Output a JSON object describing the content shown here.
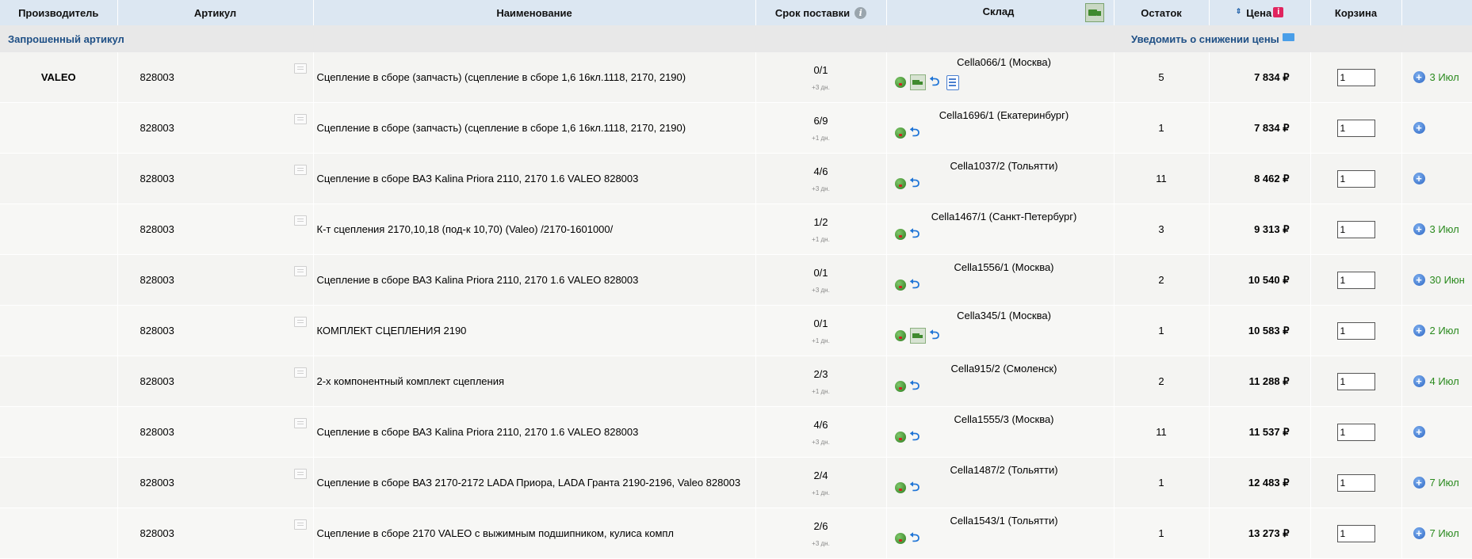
{
  "header": {
    "manufacturer": "Производитель",
    "article": "Артикул",
    "name": "Наименование",
    "delivery": "Срок поставки",
    "warehouse": "Склад",
    "stock": "Остаток",
    "price": "Цена",
    "cart": "Корзина"
  },
  "request": {
    "label": "Запрошенный артикул",
    "notify": "Уведомить о снижении цены"
  },
  "icons": {
    "info": "info-icon",
    "truck": "truck-icon",
    "return": "return-icon",
    "list": "list-icon",
    "add": "add-to-cart-icon",
    "envelope": "envelope-icon"
  },
  "colors": {
    "header_bg": "#dce7f2",
    "accent_blue": "#1e4f85",
    "date_green": "#2a8a1e"
  },
  "rows": [
    {
      "maker": "VALEO",
      "article": "828003",
      "name": "Сцепление в сборе (запчасть) (сцепление в сборе 1,6 16кл.1118, 2170, 2190)",
      "term": "0/1",
      "term_sub": "+3 дн.",
      "warehouse": "Cella066/1 (Москва)",
      "stock": "5",
      "price": "7 834 ₽",
      "qty": "1",
      "date": "3 Июл"
    },
    {
      "maker": "",
      "article": "828003",
      "name": "Сцепление в сборе (запчасть) (сцепление в сборе 1,6 16кл.1118, 2170, 2190)",
      "term": "6/9",
      "term_sub": "+1 дн.",
      "warehouse": "Cella1696/1 (Екатеринбург)",
      "stock": "1",
      "price": "7 834 ₽",
      "qty": "1",
      "date": ""
    },
    {
      "maker": "",
      "article": "828003",
      "name": "Сцепление в сборе ВАЗ Kalina Priora 2110, 2170 1.6 VALEO 828003",
      "term": "4/6",
      "term_sub": "+3 дн.",
      "warehouse": "Cella1037/2 (Тольятти)",
      "stock": "11",
      "price": "8 462 ₽",
      "qty": "1",
      "date": ""
    },
    {
      "maker": "",
      "article": "828003",
      "name": "К-т сцепления 2170,10,18 (под-к 10,70) (Valeo) /2170-1601000/",
      "term": "1/2",
      "term_sub": "+1 дн.",
      "warehouse": "Cella1467/1 (Санкт-Петербург)",
      "stock": "3",
      "price": "9 313 ₽",
      "qty": "1",
      "date": "3 Июл"
    },
    {
      "maker": "",
      "article": "828003",
      "name": "Сцепление в сборе ВАЗ Kalina Priora 2110, 2170 1.6 VALEO 828003",
      "term": "0/1",
      "term_sub": "+3 дн.",
      "warehouse": "Cella1556/1 (Москва)",
      "stock": "2",
      "price": "10 540 ₽",
      "qty": "1",
      "date": "30 Июн"
    },
    {
      "maker": "",
      "article": "828003",
      "name": "КОМПЛЕКТ СЦЕПЛЕНИЯ 2190",
      "term": "0/1",
      "term_sub": "+1 дн.",
      "warehouse": "Cella345/1 (Москва)",
      "stock": "1",
      "price": "10 583 ₽",
      "qty": "1",
      "date": "2 Июл"
    },
    {
      "maker": "",
      "article": "828003",
      "name": "2-х компонентный комплект сцепления",
      "term": "2/3",
      "term_sub": "+1 дн.",
      "warehouse": "Cella915/2 (Смоленск)",
      "stock": "2",
      "price": "11 288 ₽",
      "qty": "1",
      "date": "4 Июл"
    },
    {
      "maker": "",
      "article": "828003",
      "name": "Сцепление в сборе ВАЗ Kalina Priora 2110, 2170 1.6 VALEO 828003",
      "term": "4/6",
      "term_sub": "+3 дн.",
      "warehouse": "Cella1555/3 (Москва)",
      "stock": "11",
      "price": "11 537 ₽",
      "qty": "1",
      "date": ""
    },
    {
      "maker": "",
      "article": "828003",
      "name": "Сцепление в сборе ВАЗ 2170-2172 LADA Приора, LADA Гранта 2190-2196, Valeo 828003",
      "term": "2/4",
      "term_sub": "+1 дн.",
      "warehouse": "Cella1487/2 (Тольятти)",
      "stock": "1",
      "price": "12 483 ₽",
      "qty": "1",
      "date": "7 Июл"
    },
    {
      "maker": "",
      "article": "828003",
      "name": "Сцепление в сборе 2170 VALEO с выжимным подшипником, кулиса компл",
      "term": "2/6",
      "term_sub": "+3 дн.",
      "warehouse": "Cella1543/1 (Тольятти)",
      "stock": "1",
      "price": "13 273 ₽",
      "qty": "1",
      "date": "7 Июл"
    }
  ]
}
